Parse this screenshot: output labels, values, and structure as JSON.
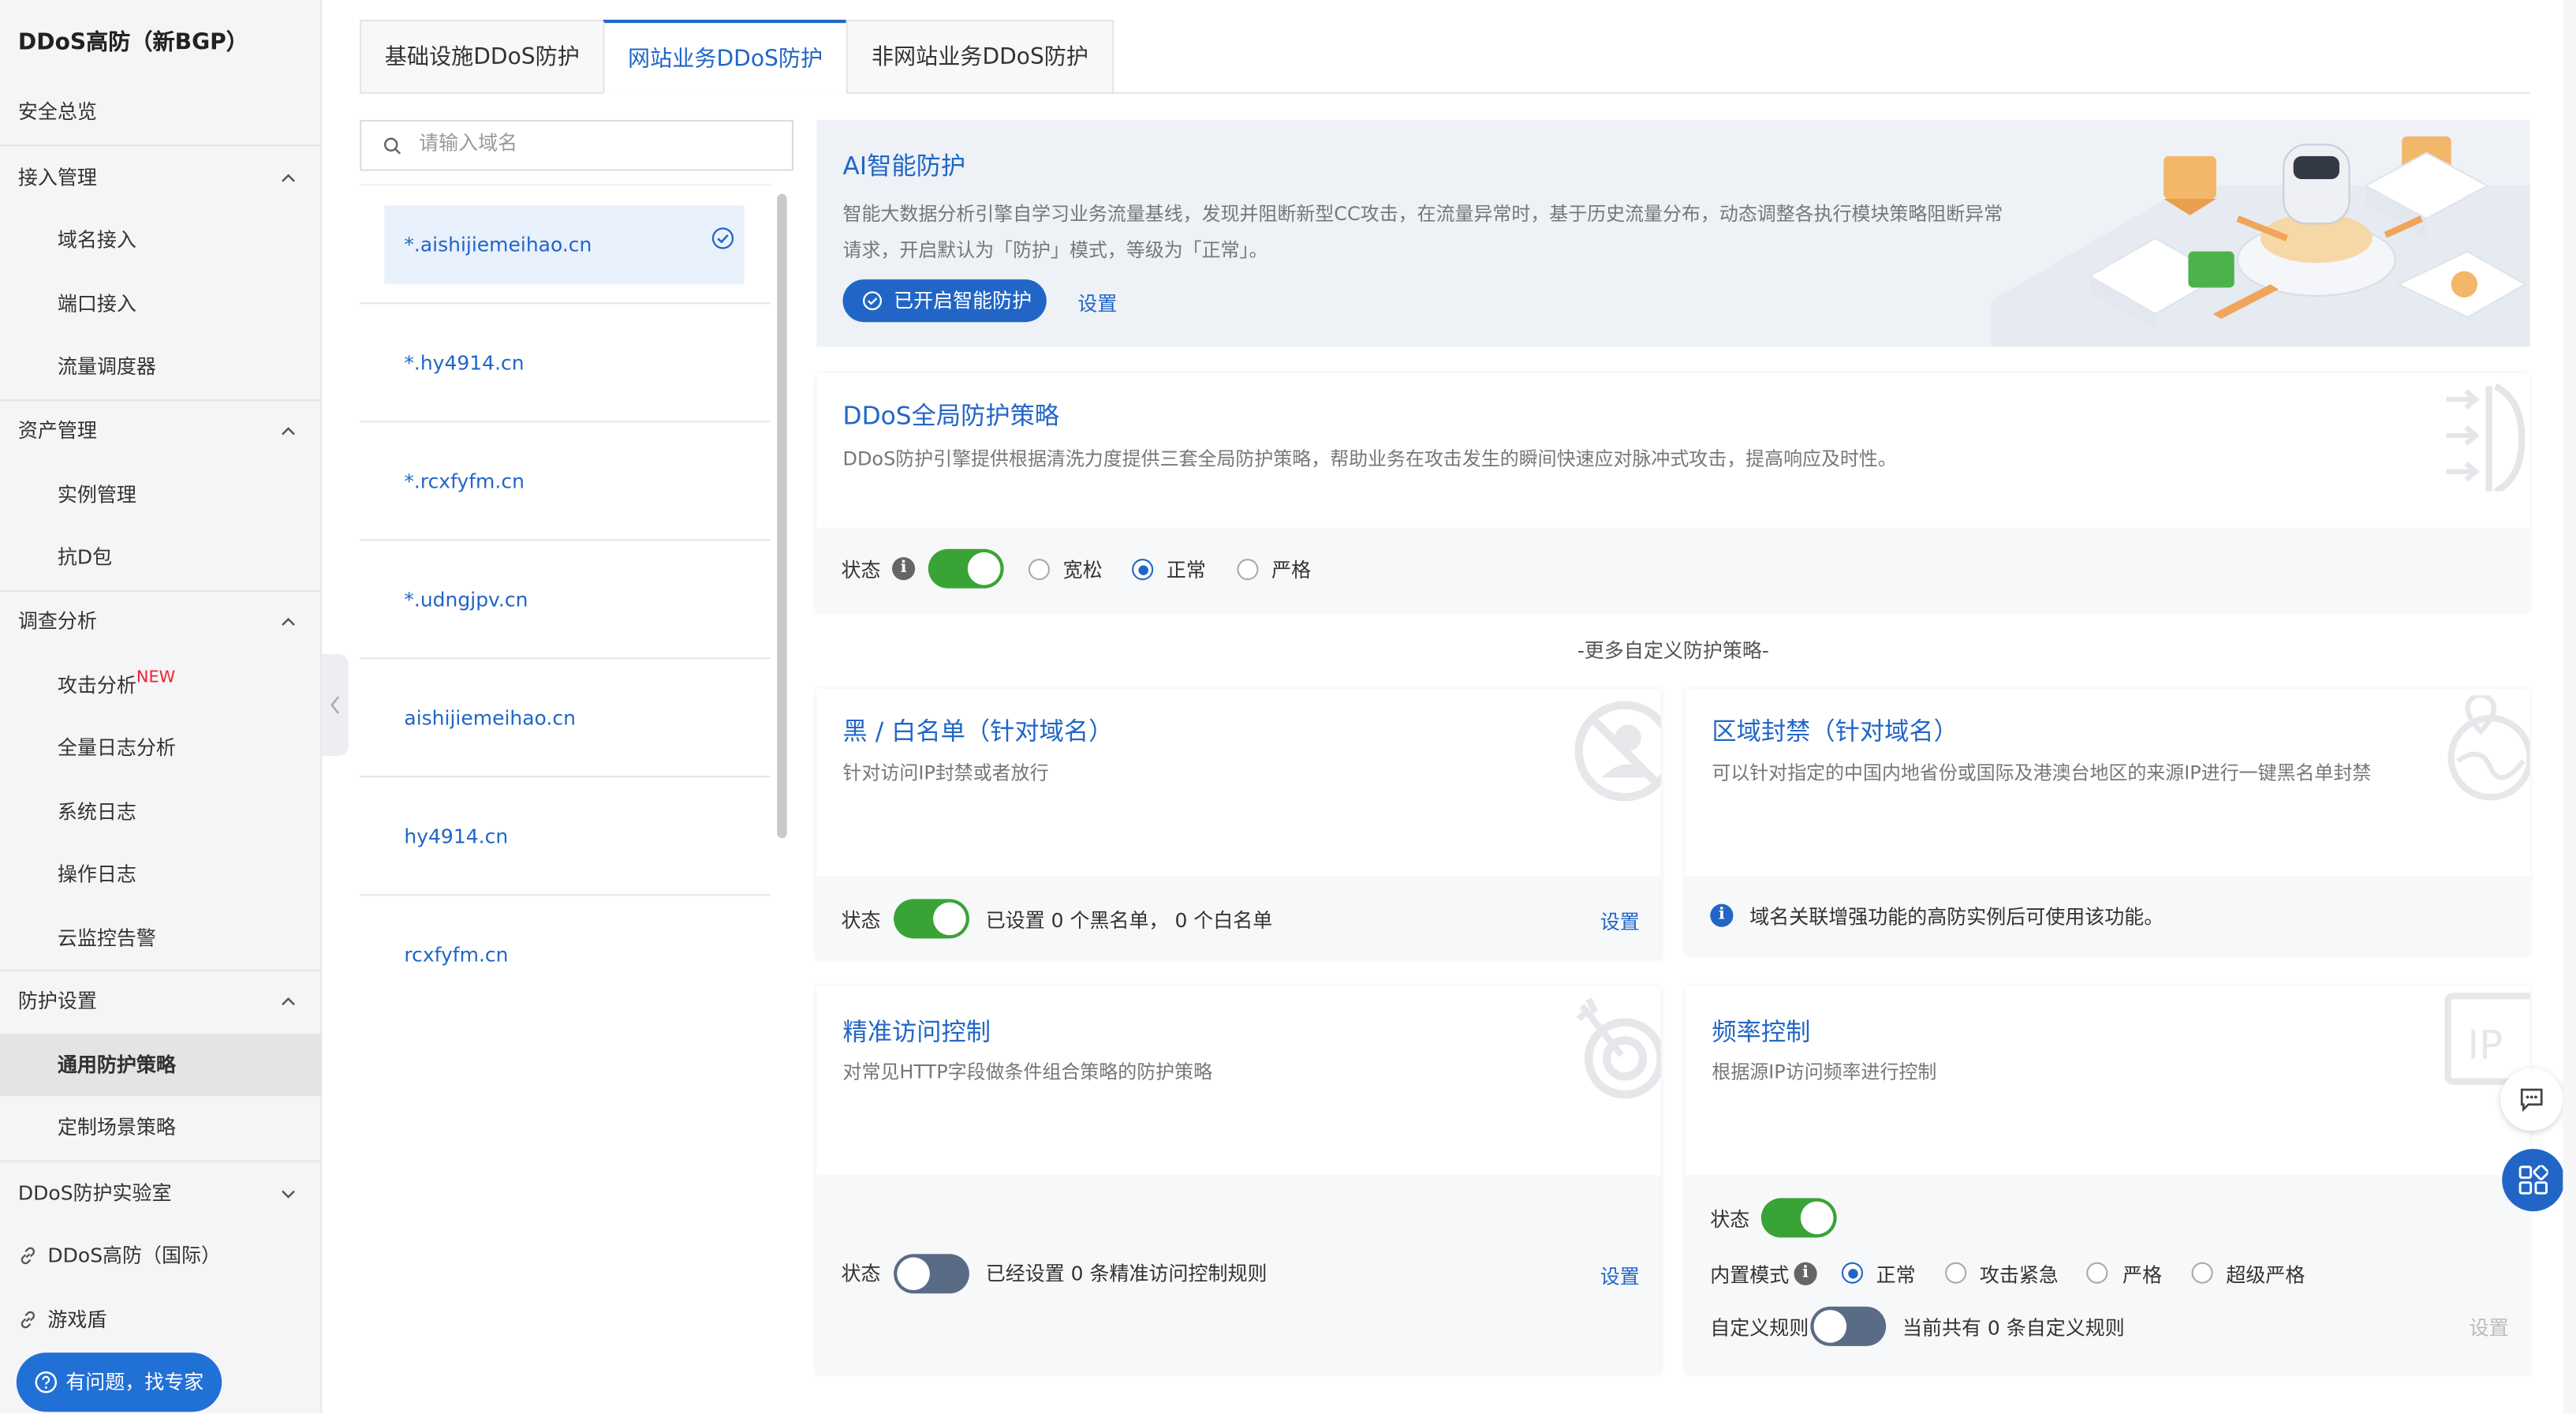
{
  "sidebar": {
    "title": "DDoS高防（新BGP）",
    "overview": "安全总览",
    "groups": [
      {
        "label": "接入管理",
        "items": [
          "域名接入",
          "端口接入",
          "流量调度器"
        ]
      },
      {
        "label": "资产管理",
        "items": [
          "实例管理",
          "抗D包"
        ]
      },
      {
        "label": "调查分析",
        "items": [
          "攻击分析",
          "全量日志分析",
          "系统日志",
          "操作日志",
          "云监控告警"
        ]
      },
      {
        "label": "防护设置",
        "items": [
          "通用防护策略",
          "定制场景策略"
        ]
      }
    ],
    "new_badge": "NEW",
    "lab": "DDoS防护实验室",
    "links": [
      "DDoS高防（国际）",
      "游戏盾"
    ],
    "expert_button": "有问题，找专家"
  },
  "tabs": [
    "基础设施DDoS防护",
    "网站业务DDoS防护",
    "非网站业务DDoS防护"
  ],
  "search": {
    "placeholder": "请输入域名",
    "value": ""
  },
  "domains": [
    "*.aishijiemeihao.cn",
    "*.hy4914.cn",
    "*.rcxfyfm.cn",
    "*.udngjpv.cn",
    "aishijiemeihao.cn",
    "hy4914.cn",
    "rcxfyfm.cn"
  ],
  "ai": {
    "title": "AI智能防护",
    "desc": "智能大数据分析引擎自学习业务流量基线，发现并阻断新型CC攻击，在流量异常时，基于历史流量分布，动态调整各执行模块策略阻断异常请求，开启默认为「防护」模式，等级为「正常」。",
    "button": "已开启智能防护",
    "settings": "设置"
  },
  "global_policy": {
    "title": "DDoS全局防护策略",
    "desc": "DDoS防护引擎提供根据清洗力度提供三套全局防护策略，帮助业务在攻击发生的瞬间快速应对脉冲式攻击，提高响应及时性。",
    "status_label": "状态",
    "status_on": true,
    "options": [
      "宽松",
      "正常",
      "严格"
    ],
    "selected": "正常"
  },
  "more_title": "-更多自定义防护策略-",
  "blacklist": {
    "title": "黑 / 白名单（针对域名）",
    "desc": "针对访问IP封禁或者放行",
    "status_label": "状态",
    "status_on": true,
    "summary": "已设置 0 个黑名单， 0 个白名单",
    "settings": "设置"
  },
  "region": {
    "title": "区域封禁（针对域名）",
    "desc": "可以针对指定的中国内地省份或国际及港澳台地区的来源IP进行一键黑名单封禁",
    "notice": "域名关联增强功能的高防实例后可使用该功能。"
  },
  "acl": {
    "title": "精准访问控制",
    "desc": "对常见HTTP字段做条件组合策略的防护策略",
    "status_label": "状态",
    "status_on": false,
    "summary": "已经设置 0 条精准访问控制规则",
    "settings": "设置"
  },
  "rate": {
    "title": "频率控制",
    "desc": "根据源IP访问频率进行控制",
    "status_label": "状态",
    "status_on": true,
    "mode_label": "内置模式",
    "modes": [
      "正常",
      "攻击紧急",
      "严格",
      "超级严格"
    ],
    "selected_mode": "正常",
    "custom_label": "自定义规则",
    "custom_on": false,
    "custom_summary": "当前共有 0 条自定义规则",
    "settings": "设置"
  },
  "colors": {
    "accent": "#2166c6",
    "toggle_on": "#3aa336",
    "toggle_off": "#5a6b86",
    "new_badge": "#e22233"
  }
}
